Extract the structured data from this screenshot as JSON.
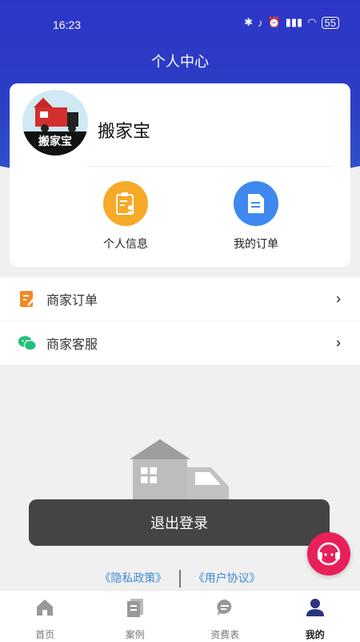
{
  "status_bar": {
    "time": "16:23",
    "battery": "55"
  },
  "header": {
    "title": "个人中心"
  },
  "profile": {
    "avatar_text": "搬家宝",
    "name": "搬家宝"
  },
  "shortcuts": [
    {
      "label": "个人信息",
      "color": "#f7a928"
    },
    {
      "label": "我的订单",
      "color": "#3e88ef"
    }
  ],
  "menu": [
    {
      "label": "商家订单"
    },
    {
      "label": "商家客服"
    }
  ],
  "logout_label": "退出登录",
  "links": {
    "privacy": "《隐私政策》",
    "agreement": "《用户协议》"
  },
  "tabs": [
    {
      "label": "首页"
    },
    {
      "label": "案例"
    },
    {
      "label": "资费表"
    },
    {
      "label": "我的"
    }
  ]
}
